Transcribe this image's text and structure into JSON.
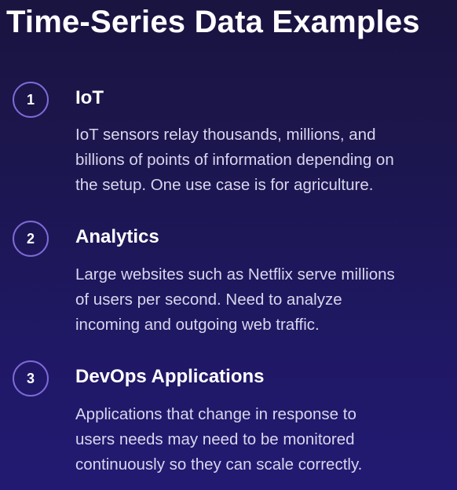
{
  "title": "Time-Series Data Examples",
  "items": [
    {
      "number": "1",
      "heading": "IoT",
      "lines": [
        "IoT sensors relay thousands, millions, and",
        "billions of points of information depending on",
        "the setup. One use case is for agriculture."
      ]
    },
    {
      "number": "2",
      "heading": "Analytics",
      "lines": [
        "Large websites such as Netflix serve millions",
        "of users per second. Need to analyze",
        "incoming and outgoing web traffic."
      ]
    },
    {
      "number": "3",
      "heading": "DevOps Applications",
      "lines": [
        "Applications that change in response to",
        "users needs may need to be monitored",
        "continuously so they can scale correctly."
      ]
    }
  ],
  "colors": {
    "background": "#1c1650",
    "circle_border": "#7e6ad6",
    "body_text": "#d9d6ee"
  }
}
